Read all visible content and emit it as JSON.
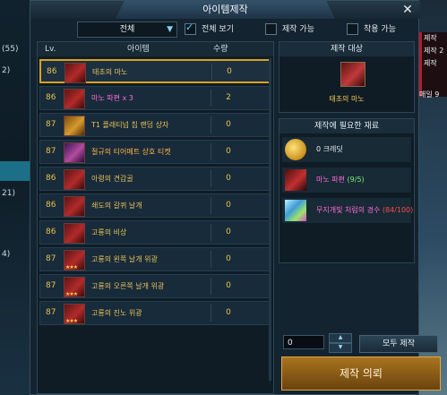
{
  "bg_left": {
    "items": [
      "(55)",
      "2)",
      "",
      "",
      "",
      "21)",
      "",
      "",
      "4)",
      ""
    ]
  },
  "bg_right": {
    "lines": [
      "제작",
      "제작 2",
      "제작"
    ],
    "bottom": "매일 9"
  },
  "window": {
    "title": "아이템제작"
  },
  "filter": {
    "category": "전체",
    "checks": [
      {
        "label": "전체 보기",
        "checked": true
      },
      {
        "label": "제작 가능",
        "checked": false
      },
      {
        "label": "착용 가능",
        "checked": false
      }
    ]
  },
  "list": {
    "headers": {
      "lv": "Lv.",
      "item": "아이템",
      "qty": "수량"
    },
    "rows": [
      {
        "lv": "86",
        "name": "태초의 마노",
        "qty": "0",
        "icon": "red-gem-icon"
      },
      {
        "lv": "86",
        "name": "마노 파편 x 3",
        "qty": "2",
        "icon": "red-fragment-icon"
      },
      {
        "lv": "87",
        "name": "T1 플래티넘 칩 랜덤 상자",
        "qty": "0",
        "icon": "treasure-chest-icon"
      },
      {
        "lv": "87",
        "name": "절규의 티어메트 상호 티켓",
        "qty": "0",
        "icon": "ticket-icon"
      },
      {
        "lv": "86",
        "name": "아령의 견갑골",
        "qty": "0",
        "icon": "red-wing-icon"
      },
      {
        "lv": "86",
        "name": "쇄도의 갈퀴 날개",
        "qty": "0",
        "icon": "red-wing-icon"
      },
      {
        "lv": "86",
        "name": "고룡의 비상",
        "qty": "0",
        "icon": "red-wing-icon"
      },
      {
        "lv": "87",
        "name": "고룡의 왼쪽 날개 위광",
        "qty": "0",
        "icon": "red-wing-icon"
      },
      {
        "lv": "87",
        "name": "고룡의 오른쪽 날개 위광",
        "qty": "0",
        "icon": "red-wing-icon"
      },
      {
        "lv": "87",
        "name": "고룡의 진노 위광",
        "qty": "0",
        "icon": "red-wing-icon"
      }
    ]
  },
  "target": {
    "title": "제작 대상",
    "name": "태초의 마노"
  },
  "materials": {
    "title": "제작에 필요한 재료",
    "items": [
      {
        "name": "0 크레딧",
        "progress": "",
        "icon": "gold-coin-icon"
      },
      {
        "name": "마노 파편",
        "progress": "(9/5)",
        "icon": "red-fragment-icon"
      },
      {
        "name": "무지개빛 처럼의 경수",
        "progress": "(84/100)",
        "icon": "rainbow-crystal-icon"
      }
    ]
  },
  "controls": {
    "quantity": "0",
    "all_craft": "모두 제작",
    "craft": "제작 의뢰"
  }
}
